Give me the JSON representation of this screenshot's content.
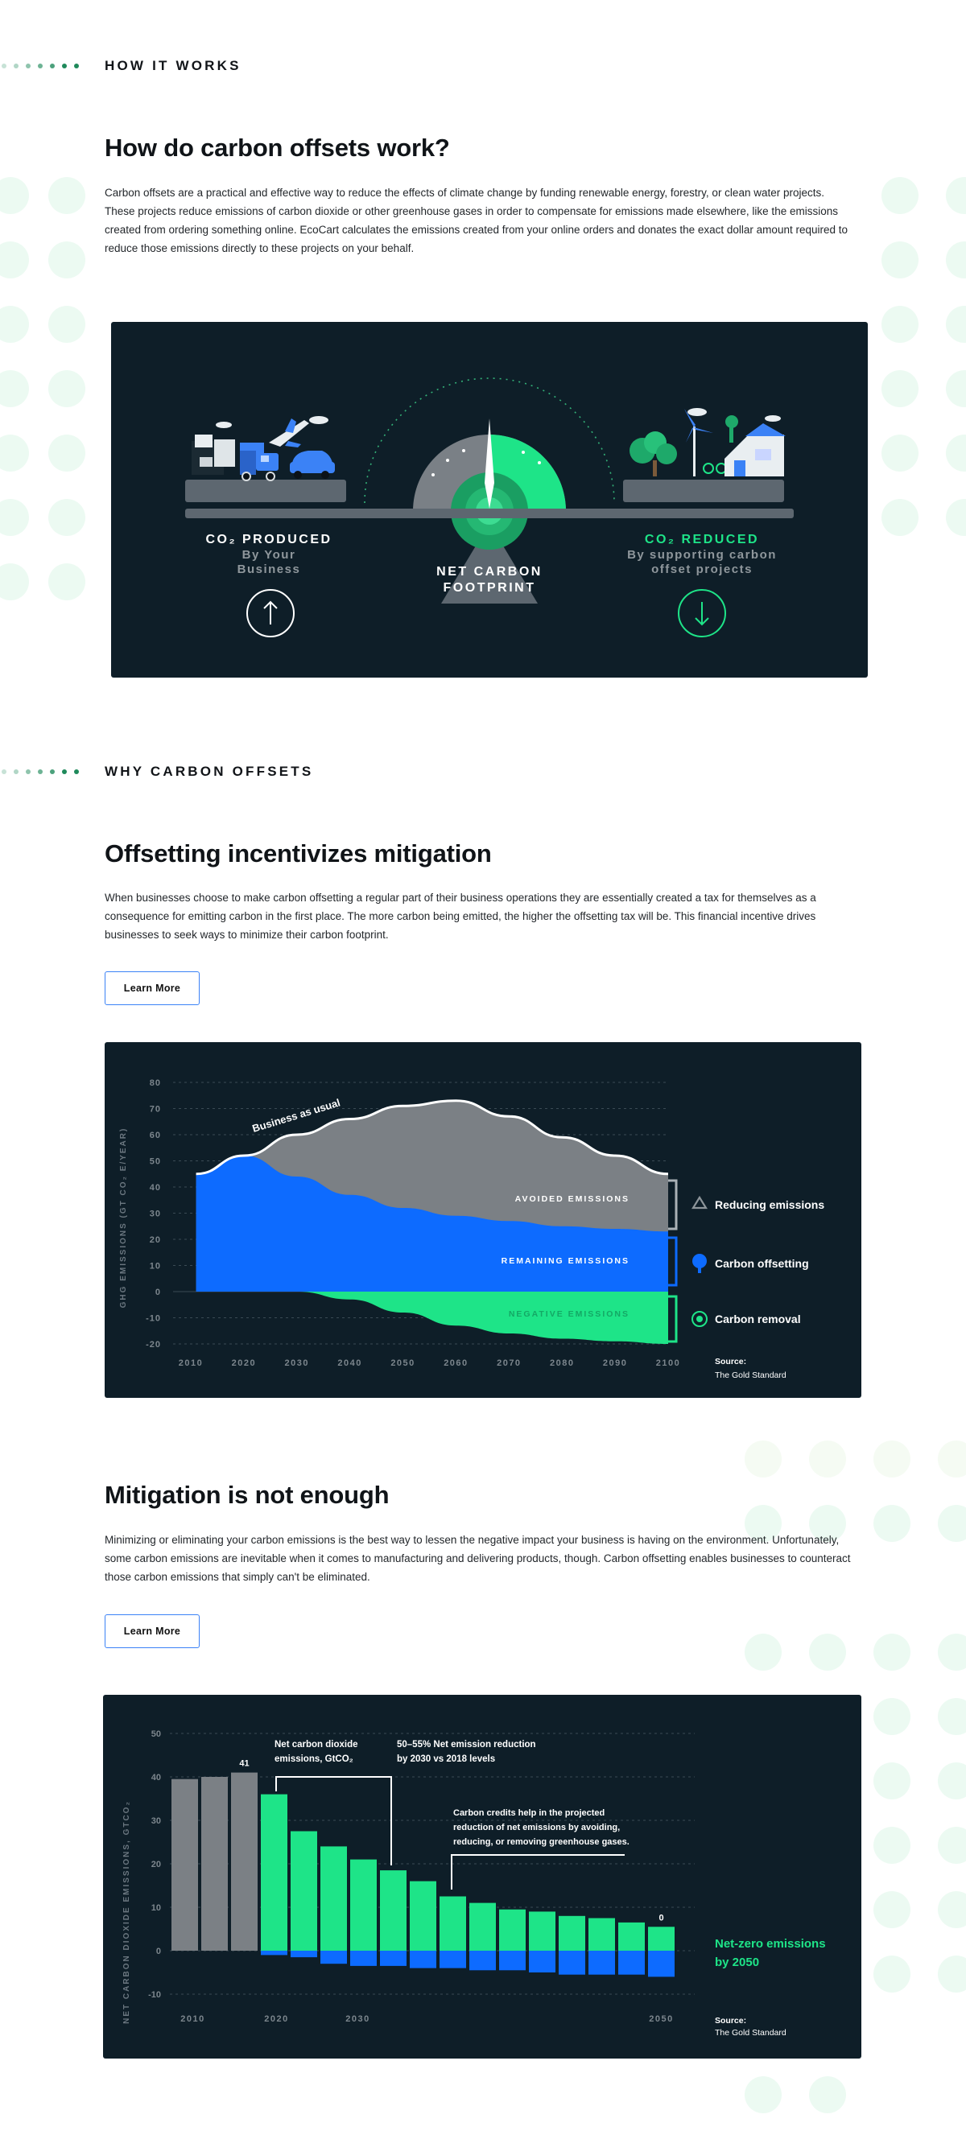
{
  "colors": {
    "accent_green": "#1ee488",
    "accent_blue": "#0d6bff",
    "panel_bg": "#0e1e28",
    "gray": "#7a7f83",
    "dot_green": "#1f8a5b"
  },
  "how": {
    "eyebrow": "HOW IT WORKS",
    "title": "How do carbon offsets work?",
    "body": "Carbon offsets are a practical and effective way to reduce the effects of climate change by funding renewable energy, forestry, or clean water projects. These projects reduce emissions of carbon dioxide or other greenhouse gases in order to compensate for emissions made elsewhere, like the emissions created from ordering something online. EcoCart calculates the emissions created from your online orders and donates the exact dollar amount required to reduce those emissions directly to these projects on your behalf.",
    "illustration": {
      "left_title": "CO₂ PRODUCED",
      "left_sub1": "By Your",
      "left_sub2": "Business",
      "center1": "NET CARBON",
      "center2": "FOOTPRINT",
      "right_title": "CO₂ REDUCED",
      "right_sub1": "By supporting carbon",
      "right_sub2": "offset projects",
      "up_icon": "arrow-up-icon",
      "down_icon": "arrow-down-icon"
    }
  },
  "why": {
    "eyebrow": "WHY CARBON OFFSETS",
    "title": "Offsetting incentivizes mitigation",
    "body": "When businesses choose to make carbon offsetting a regular part of their business operations they are essentially created a tax for themselves as a consequence for emitting carbon in the first place. The more carbon being emitted, the higher the offsetting tax will be. This financial incentive drives businesses to seek ways to minimize their carbon footprint.",
    "button": "Learn More"
  },
  "mitigation": {
    "title": "Mitigation is not enough",
    "body": "Minimizing or eliminating your carbon emissions is the best way to lessen the negative impact your business is having on the environment. Unfortunately, some carbon emissions are inevitable when it comes to manufacturing and delivering products, though. Carbon offsetting enables businesses to counteract those carbon emissions that simply can't be eliminated.",
    "button": "Learn More"
  },
  "chart_data": [
    {
      "type": "area",
      "title": "",
      "ylabel": "GHG EMISSIONS (GT CO₂ E/YEAR)",
      "xlabel": "",
      "x": [
        2010,
        2020,
        2030,
        2040,
        2050,
        2060,
        2070,
        2080,
        2090,
        2100
      ],
      "xlim": [
        2010,
        2100
      ],
      "ylim": [
        -20,
        80
      ],
      "yticks": [
        80,
        70,
        60,
        50,
        40,
        30,
        20,
        10,
        0,
        -10,
        -20
      ],
      "grid": true,
      "curve_label": "Business as usual",
      "series": [
        {
          "name": "AVOIDED EMISSIONS",
          "values": [
            45,
            52,
            60,
            66,
            71,
            73,
            67,
            59,
            52,
            45
          ]
        },
        {
          "name": "REMAINING EMISSIONS",
          "values": [
            45,
            52,
            44,
            37,
            32,
            29,
            27,
            25,
            24,
            23
          ]
        },
        {
          "name": "NEGATIVE EMISSIONS",
          "values": [
            0,
            0,
            0,
            -3,
            -8,
            -13,
            -16,
            -18,
            -19,
            -20
          ]
        }
      ],
      "legend": [
        {
          "label": "Reducing emissions",
          "icon": "recycle-icon"
        },
        {
          "label": "Carbon offsetting",
          "icon": "tree-icon"
        },
        {
          "label": "Carbon removal",
          "icon": "target-icon"
        }
      ],
      "source_label": "Source:",
      "source": "The Gold Standard"
    },
    {
      "type": "bar",
      "title": "",
      "ylabel": "NET CARBON DIOXIDE EMISSIONS, GTCO₂",
      "ylim": [
        -10,
        50
      ],
      "yticks": [
        50,
        40,
        30,
        20,
        10,
        0,
        -10
      ],
      "xticks": [
        "2010",
        "2020",
        "2030",
        "2050"
      ],
      "grid": true,
      "historical": [
        39.5,
        40,
        41
      ],
      "positive": [
        36,
        27.5,
        24,
        21,
        18.5,
        16,
        12.5,
        11,
        9.5,
        9,
        8,
        7.5,
        6.5,
        5.5
      ],
      "negative": [
        -1,
        -1.5,
        -3,
        -3.5,
        -3.5,
        -4,
        -4,
        -4.5,
        -4.5,
        -5,
        -5.5,
        -5.5,
        -5.5,
        -6
      ],
      "value_labels": [
        "41",
        "0"
      ],
      "annotations": [
        {
          "line1": "Net carbon dioxide",
          "line2": "emissions, GtCO₂"
        },
        {
          "line1": "50–55% Net emission reduction",
          "line2": "by 2030 vs 2018 levels"
        },
        {
          "line1": "Carbon credits help in the projected",
          "line2": "reduction of net emissions by avoiding,",
          "line3": "reducing, or removing greenhouse gases."
        }
      ],
      "callout1": "Net-zero emissions",
      "callout2": "by 2050",
      "source_label": "Source:",
      "source": "The Gold Standard"
    }
  ]
}
